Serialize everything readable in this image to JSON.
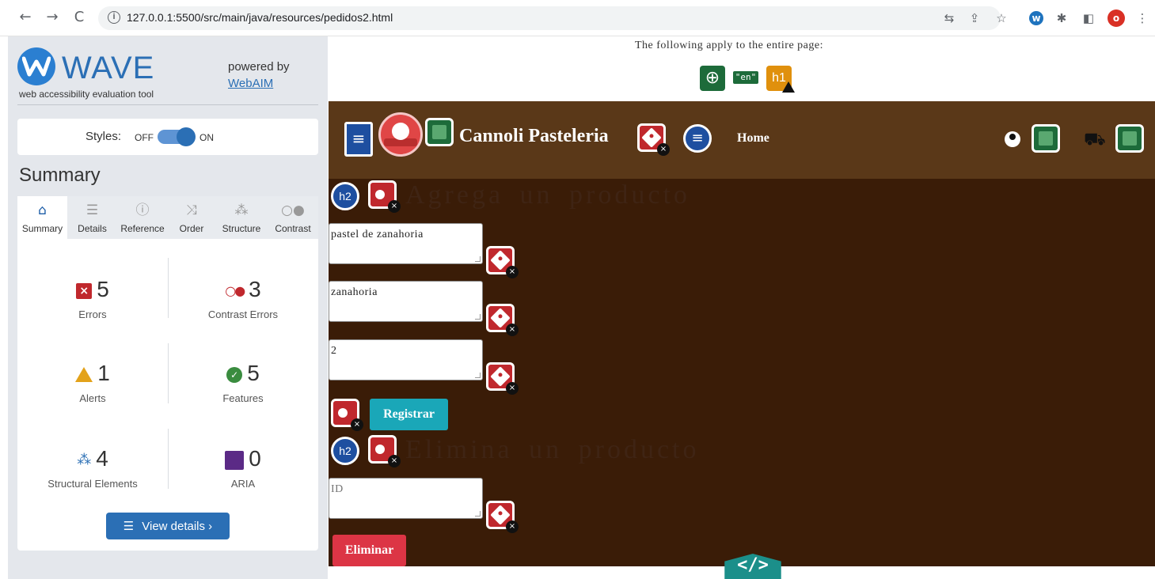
{
  "browser": {
    "url": "127.0.0.1:5500/src/main/java/resources/pedidos2.html",
    "profile_initial": "o"
  },
  "wave": {
    "title": "WAVE",
    "subtitle": "web accessibility evaluation tool",
    "powered_by": "powered by",
    "webaim_link": "WebAIM",
    "styles_label": "Styles:",
    "styles_off": "OFF",
    "styles_on": "ON",
    "styles_state": "on",
    "summary_heading": "Summary",
    "tabs": [
      {
        "label": "Summary",
        "icon": "home-icon"
      },
      {
        "label": "Details",
        "icon": "list-icon"
      },
      {
        "label": "Reference",
        "icon": "info-icon"
      },
      {
        "label": "Order",
        "icon": "order-icon"
      },
      {
        "label": "Structure",
        "icon": "structure-icon"
      },
      {
        "label": "Contrast",
        "icon": "contrast-icon"
      }
    ],
    "stats": {
      "errors": {
        "count": "5",
        "label": "Errors",
        "color": "#c0282d"
      },
      "contrast": {
        "count": "3",
        "label": "Contrast Errors",
        "color": "#c0282d"
      },
      "alerts": {
        "count": "1",
        "label": "Alerts",
        "color": "#e3a21a"
      },
      "features": {
        "count": "5",
        "label": "Features",
        "color": "#3a8c3f"
      },
      "structural": {
        "count": "4",
        "label": "Structural Elements",
        "color": "#2b6fb5"
      },
      "aria": {
        "count": "0",
        "label": "ARIA",
        "color": "#5b2a86"
      }
    },
    "view_details": "View details ›"
  },
  "page": {
    "apply_text": "The following apply to the entire page:",
    "lang_badge": "\"en\"",
    "h1_badge": "h1",
    "brand": "Cannoli  Pasteleria",
    "home_link": "Home",
    "h2_badge": "h2",
    "heading_add": "Agrega un producto",
    "heading_delete": "Elimina un producto",
    "field_name": "pastel de zanahoria",
    "field_ingredient": "zanahoria",
    "field_qty": "2",
    "field_id_placeholder": "ID",
    "register_button": "Registrar",
    "delete_button": "Eliminar",
    "code_badge": "</>",
    "colors": {
      "header_bg": "#5a3818",
      "main_bg": "#3a1c07",
      "register_btn": "#1aa7b8",
      "delete_btn": "#dc3545"
    }
  }
}
